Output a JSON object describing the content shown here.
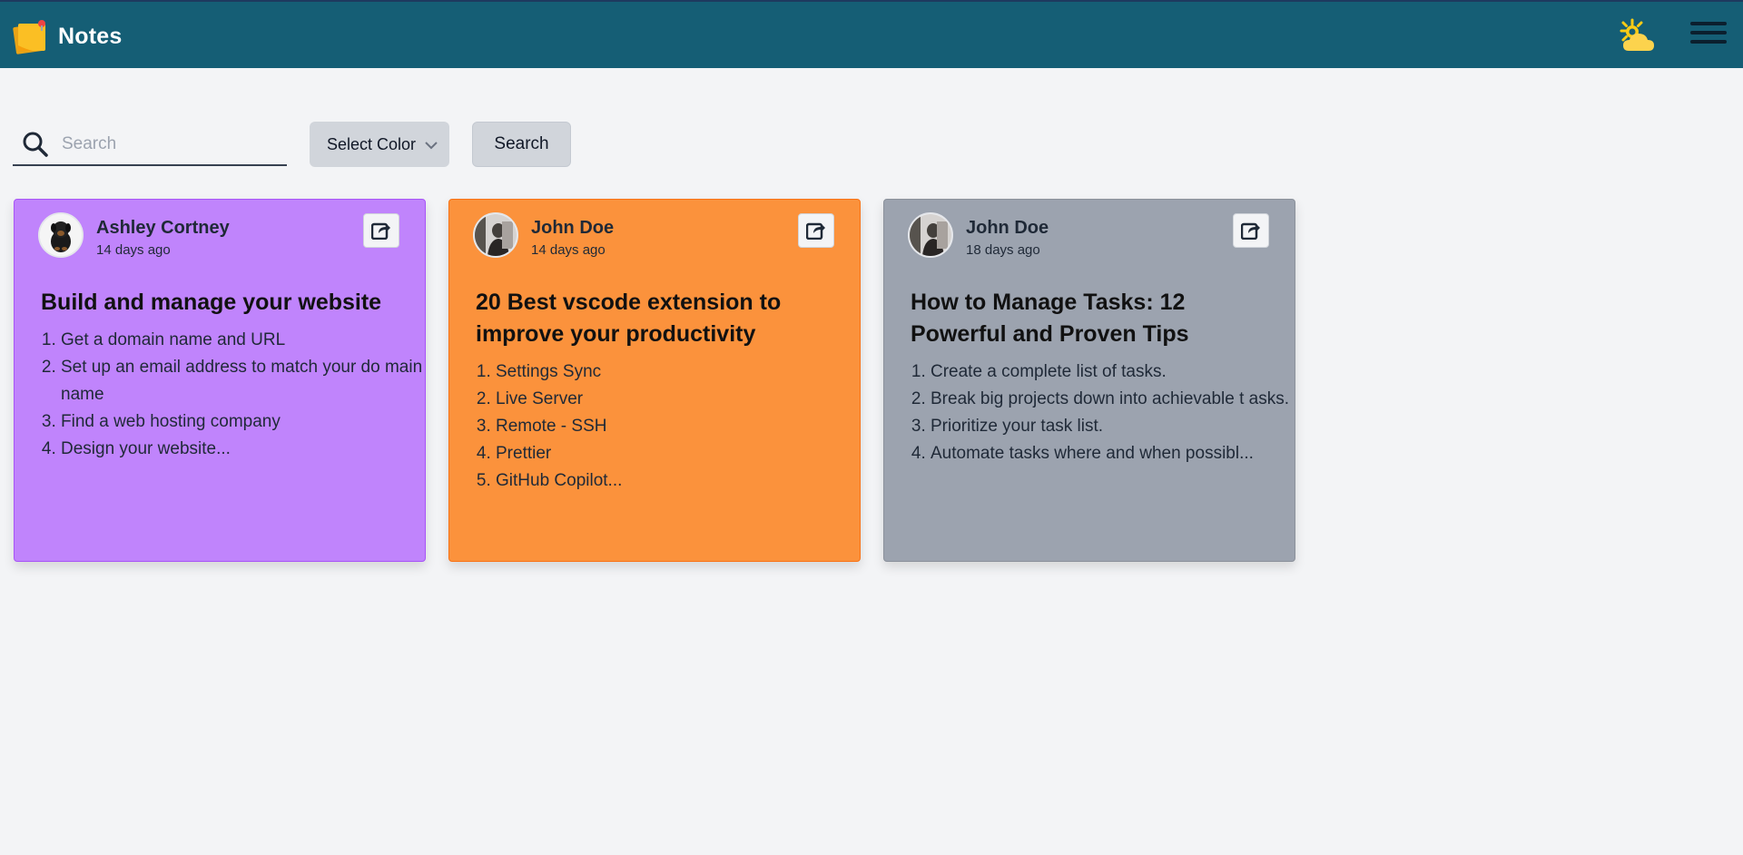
{
  "header": {
    "app_title": "Notes",
    "logo_icon": "sticky-note-icon",
    "theme_icon": "sun-cloud-icon",
    "menu_icon": "hamburger-menu-icon",
    "bar_color": "#155e75"
  },
  "filters": {
    "search_placeholder": "Search",
    "search_value": "",
    "select_color_label": "Select Color",
    "search_button_label": "Search"
  },
  "notes": [
    {
      "author": "Ashley Cortney",
      "time": "14 days ago",
      "title": "Build and manage your website",
      "color": "#c084fc",
      "items": [
        "Get a domain name and URL",
        "Set up an email address to match your do main name",
        "Find a web hosting company",
        "Design your website..."
      ]
    },
    {
      "author": "John Doe",
      "time": "14 days ago",
      "title": "20 Best vscode extension to improve your productivity",
      "color": "#fb923c",
      "items": [
        "Settings Sync",
        "Live Server",
        "Remote - SSH",
        "Prettier",
        "GitHub Copilot..."
      ]
    },
    {
      "author": "John Doe",
      "time": "18 days ago",
      "title": "How to Manage Tasks: 12 Powerful and Proven Tips",
      "color": "#9ca3af",
      "items": [
        "Create a complete list of tasks.",
        "Break big projects down into achievable t asks.",
        "Prioritize your task list.",
        "Automate tasks where and when possibl..."
      ]
    }
  ]
}
